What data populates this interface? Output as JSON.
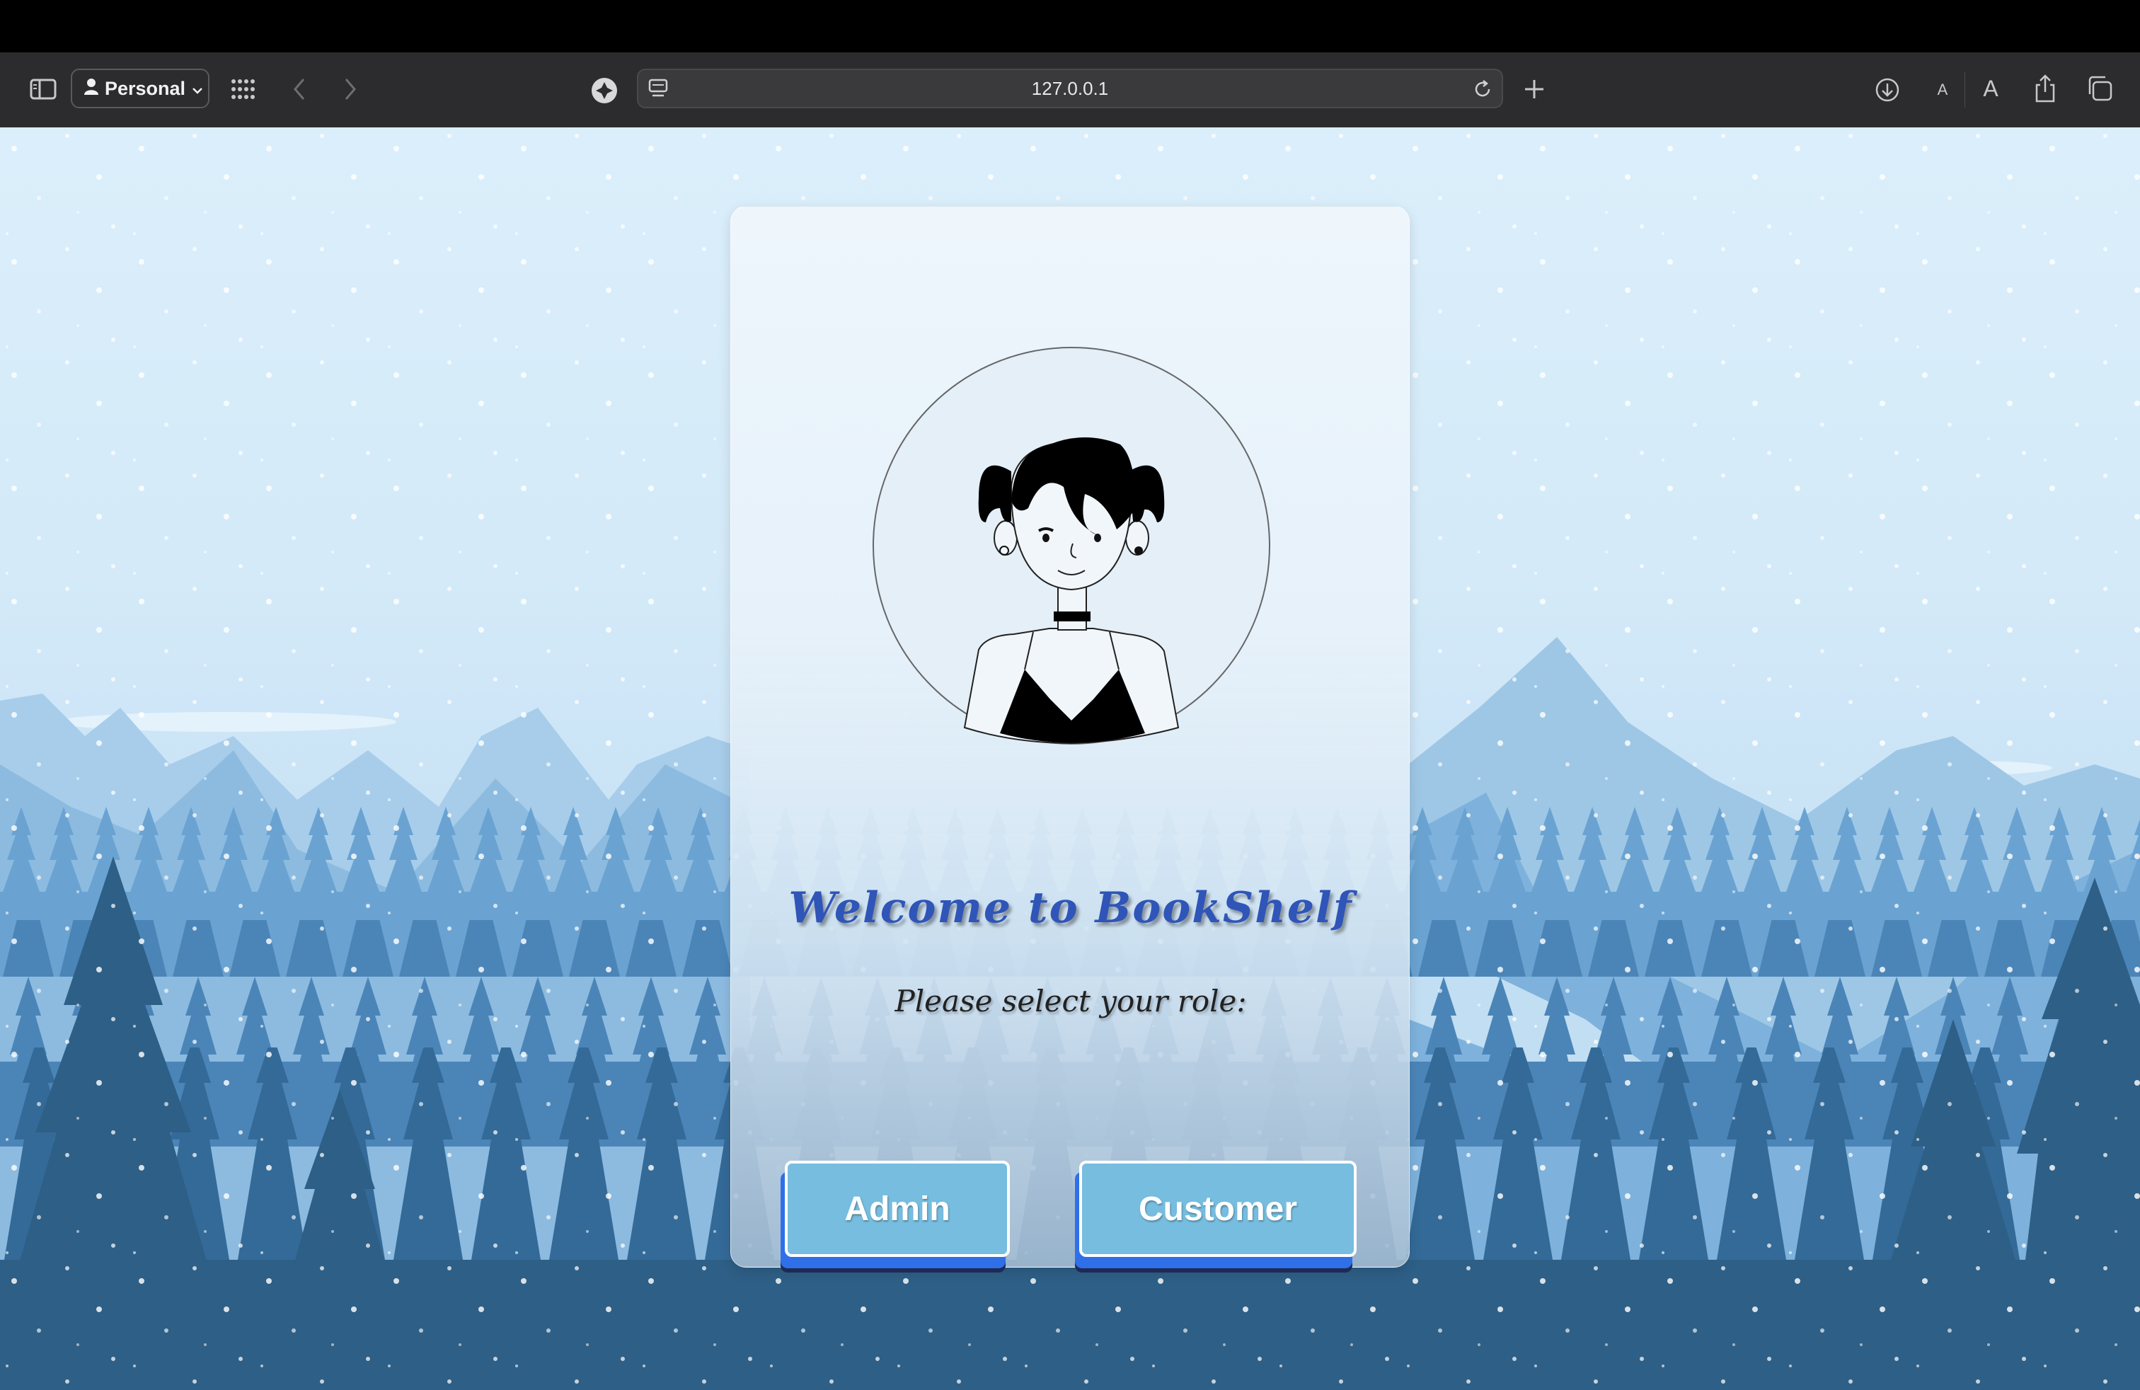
{
  "browser": {
    "profile_label": "Personal",
    "url": "127.0.0.1",
    "font_small_label": "A",
    "font_large_label": "A"
  },
  "card": {
    "title": "Welcome to BookShelf",
    "subtitle": "Please select your role:",
    "admin_button": "Admin",
    "customer_button": "Customer"
  },
  "colors": {
    "button_face": "#76bddf",
    "button_depth": "#2f6fe8",
    "title": "#2f55b8",
    "forest_dark": "#2e5f86"
  }
}
